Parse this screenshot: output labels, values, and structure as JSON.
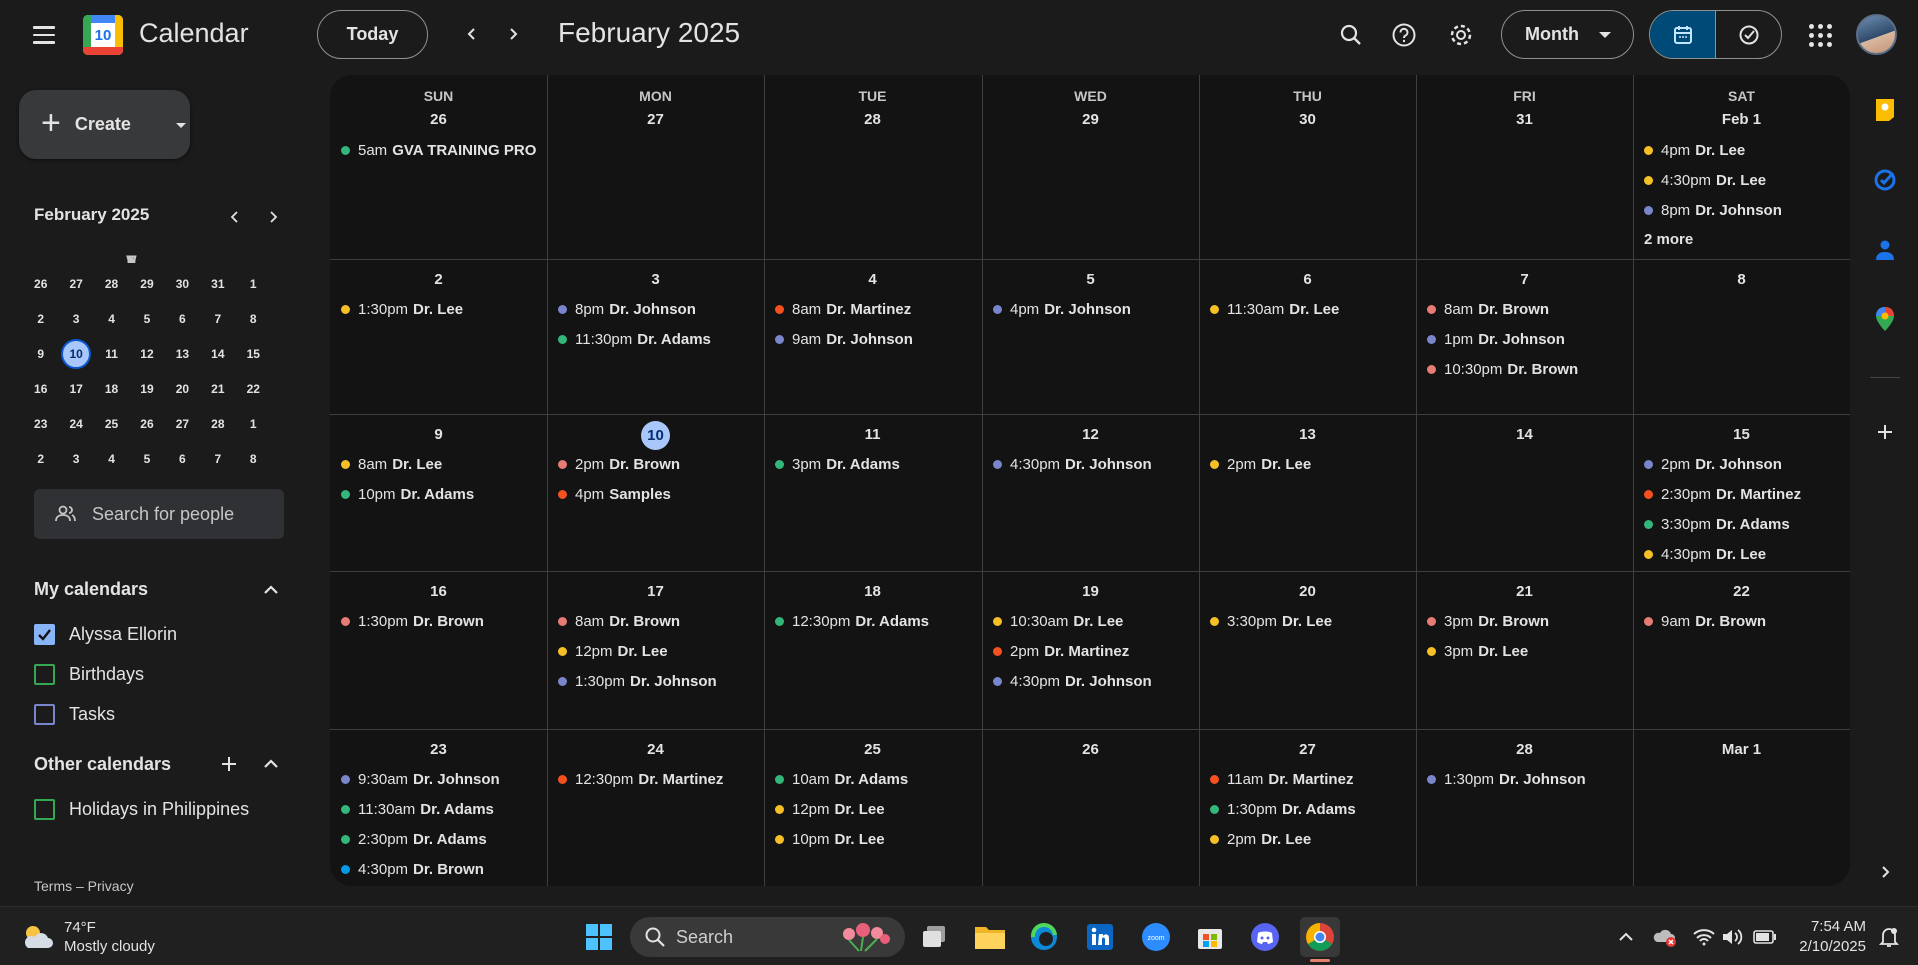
{
  "header": {
    "app_title": "Calendar",
    "logo_day": "10",
    "today_label": "Today",
    "month_title": "February 2025",
    "view_label": "Month"
  },
  "sidebar": {
    "create_label": "Create",
    "mini": {
      "title": "February 2025",
      "dow": [
        "S",
        "M",
        "T",
        "W",
        "T",
        "F",
        "S"
      ],
      "weeks": [
        [
          "26",
          "27",
          "28",
          "29",
          "30",
          "31",
          "1"
        ],
        [
          "2",
          "3",
          "4",
          "5",
          "6",
          "7",
          "8"
        ],
        [
          "9",
          "10",
          "11",
          "12",
          "13",
          "14",
          "15"
        ],
        [
          "16",
          "17",
          "18",
          "19",
          "20",
          "21",
          "22"
        ],
        [
          "23",
          "24",
          "25",
          "26",
          "27",
          "28",
          "1"
        ],
        [
          "2",
          "3",
          "4",
          "5",
          "6",
          "7",
          "8"
        ]
      ],
      "selected": "10"
    },
    "search_placeholder": "Search for people",
    "my_calendars_title": "My calendars",
    "my_calendars": [
      {
        "label": "Alyssa Ellorin",
        "color": "#8ab4f8",
        "checked": true
      },
      {
        "label": "Birthdays",
        "color": "#34a853",
        "checked": false
      },
      {
        "label": "Tasks",
        "color": "#7986cb",
        "checked": false
      }
    ],
    "other_calendars_title": "Other calendars",
    "other_calendars": [
      {
        "label": "Holidays in Philippines",
        "color": "#34a853",
        "checked": false
      }
    ],
    "footer": "Terms – Privacy"
  },
  "calendar": {
    "dow": [
      "SUN",
      "MON",
      "TUE",
      "WED",
      "THU",
      "FRI",
      "SAT"
    ],
    "colors": {
      "green": "#33b679",
      "yellow": "#f6bf26",
      "lavender": "#7986cb",
      "red": "#e67c73",
      "tomato": "#f4511e",
      "blue": "#039be5"
    },
    "weeks": [
      {
        "days": [
          {
            "num": "26",
            "events": [
              {
                "time": "5am",
                "title": "GVA TRAINING PRO '",
                "color": "green"
              }
            ]
          },
          {
            "num": "27",
            "events": []
          },
          {
            "num": "28",
            "events": []
          },
          {
            "num": "29",
            "events": []
          },
          {
            "num": "30",
            "events": []
          },
          {
            "num": "31",
            "events": []
          },
          {
            "num": "Feb 1",
            "events": [
              {
                "time": "4pm",
                "title": "Dr. Lee",
                "color": "yellow"
              },
              {
                "time": "4:30pm",
                "title": "Dr. Lee",
                "color": "yellow"
              },
              {
                "time": "8pm",
                "title": "Dr. Johnson",
                "color": "lavender"
              }
            ],
            "more": "2 more"
          }
        ]
      },
      {
        "days": [
          {
            "num": "2",
            "events": [
              {
                "time": "1:30pm",
                "title": "Dr. Lee",
                "color": "yellow"
              }
            ]
          },
          {
            "num": "3",
            "events": [
              {
                "time": "8pm",
                "title": "Dr. Johnson",
                "color": "lavender"
              },
              {
                "time": "11:30pm",
                "title": "Dr. Adams",
                "color": "green"
              }
            ]
          },
          {
            "num": "4",
            "events": [
              {
                "time": "8am",
                "title": "Dr. Martinez",
                "color": "tomato"
              },
              {
                "time": "9am",
                "title": "Dr. Johnson",
                "color": "lavender"
              }
            ]
          },
          {
            "num": "5",
            "events": [
              {
                "time": "4pm",
                "title": "Dr. Johnson",
                "color": "lavender"
              }
            ]
          },
          {
            "num": "6",
            "events": [
              {
                "time": "11:30am",
                "title": "Dr. Lee",
                "color": "yellow"
              }
            ]
          },
          {
            "num": "7",
            "events": [
              {
                "time": "8am",
                "title": "Dr. Brown",
                "color": "red"
              },
              {
                "time": "1pm",
                "title": "Dr. Johnson",
                "color": "lavender"
              },
              {
                "time": "10:30pm",
                "title": "Dr. Brown",
                "color": "red"
              }
            ]
          },
          {
            "num": "8",
            "events": []
          }
        ]
      },
      {
        "days": [
          {
            "num": "9",
            "events": [
              {
                "time": "8am",
                "title": "Dr. Lee",
                "color": "yellow"
              },
              {
                "time": "10pm",
                "title": "Dr. Adams",
                "color": "green"
              }
            ]
          },
          {
            "num": "10",
            "today": true,
            "events": [
              {
                "time": "2pm",
                "title": "Dr. Brown",
                "color": "red"
              },
              {
                "time": "4pm",
                "title": "Samples",
                "color": "tomato"
              }
            ]
          },
          {
            "num": "11",
            "events": [
              {
                "time": "3pm",
                "title": "Dr. Adams",
                "color": "green"
              }
            ]
          },
          {
            "num": "12",
            "events": [
              {
                "time": "4:30pm",
                "title": "Dr. Johnson",
                "color": "lavender"
              }
            ]
          },
          {
            "num": "13",
            "events": [
              {
                "time": "2pm",
                "title": "Dr. Lee",
                "color": "yellow"
              }
            ]
          },
          {
            "num": "14",
            "events": []
          },
          {
            "num": "15",
            "events": [
              {
                "time": "2pm",
                "title": "Dr. Johnson",
                "color": "lavender"
              },
              {
                "time": "2:30pm",
                "title": "Dr. Martinez",
                "color": "tomato"
              },
              {
                "time": "3:30pm",
                "title": "Dr. Adams",
                "color": "green"
              },
              {
                "time": "4:30pm",
                "title": "Dr. Lee",
                "color": "yellow"
              }
            ]
          }
        ]
      },
      {
        "days": [
          {
            "num": "16",
            "events": [
              {
                "time": "1:30pm",
                "title": "Dr. Brown",
                "color": "red"
              }
            ]
          },
          {
            "num": "17",
            "events": [
              {
                "time": "8am",
                "title": "Dr. Brown",
                "color": "red"
              },
              {
                "time": "12pm",
                "title": "Dr. Lee",
                "color": "yellow"
              },
              {
                "time": "1:30pm",
                "title": "Dr. Johnson",
                "color": "lavender"
              }
            ]
          },
          {
            "num": "18",
            "events": [
              {
                "time": "12:30pm",
                "title": "Dr. Adams",
                "color": "green"
              }
            ]
          },
          {
            "num": "19",
            "events": [
              {
                "time": "10:30am",
                "title": "Dr. Lee",
                "color": "yellow"
              },
              {
                "time": "2pm",
                "title": "Dr. Martinez",
                "color": "tomato"
              },
              {
                "time": "4:30pm",
                "title": "Dr. Johnson",
                "color": "lavender"
              }
            ]
          },
          {
            "num": "20",
            "events": [
              {
                "time": "3:30pm",
                "title": "Dr. Lee",
                "color": "yellow"
              }
            ]
          },
          {
            "num": "21",
            "events": [
              {
                "time": "3pm",
                "title": "Dr. Brown",
                "color": "red"
              },
              {
                "time": "3pm",
                "title": "Dr. Lee",
                "color": "yellow"
              }
            ]
          },
          {
            "num": "22",
            "events": [
              {
                "time": "9am",
                "title": "Dr. Brown",
                "color": "red"
              }
            ]
          }
        ]
      },
      {
        "days": [
          {
            "num": "23",
            "events": [
              {
                "time": "9:30am",
                "title": "Dr. Johnson",
                "color": "lavender"
              },
              {
                "time": "11:30am",
                "title": "Dr. Adams",
                "color": "green"
              },
              {
                "time": "2:30pm",
                "title": "Dr. Adams",
                "color": "green"
              },
              {
                "time": "4:30pm",
                "title": "Dr. Brown",
                "color": "blue"
              }
            ]
          },
          {
            "num": "24",
            "events": [
              {
                "time": "12:30pm",
                "title": "Dr. Martinez",
                "color": "tomato"
              }
            ]
          },
          {
            "num": "25",
            "events": [
              {
                "time": "10am",
                "title": "Dr. Adams",
                "color": "green"
              },
              {
                "time": "12pm",
                "title": "Dr. Lee",
                "color": "yellow"
              },
              {
                "time": "10pm",
                "title": "Dr. Lee",
                "color": "yellow"
              }
            ]
          },
          {
            "num": "26",
            "events": []
          },
          {
            "num": "27",
            "events": [
              {
                "time": "11am",
                "title": "Dr. Martinez",
                "color": "tomato"
              },
              {
                "time": "1:30pm",
                "title": "Dr. Adams",
                "color": "green"
              },
              {
                "time": "2pm",
                "title": "Dr. Lee",
                "color": "yellow"
              }
            ]
          },
          {
            "num": "28",
            "events": [
              {
                "time": "1:30pm",
                "title": "Dr. Johnson",
                "color": "lavender"
              }
            ]
          },
          {
            "num": "Mar 1",
            "events": []
          }
        ]
      }
    ]
  },
  "taskbar": {
    "temperature": "74°F",
    "weather": "Mostly cloudy",
    "search_label": "Search",
    "time": "7:54 AM",
    "date": "2/10/2025",
    "zoom_label": "zoom"
  }
}
